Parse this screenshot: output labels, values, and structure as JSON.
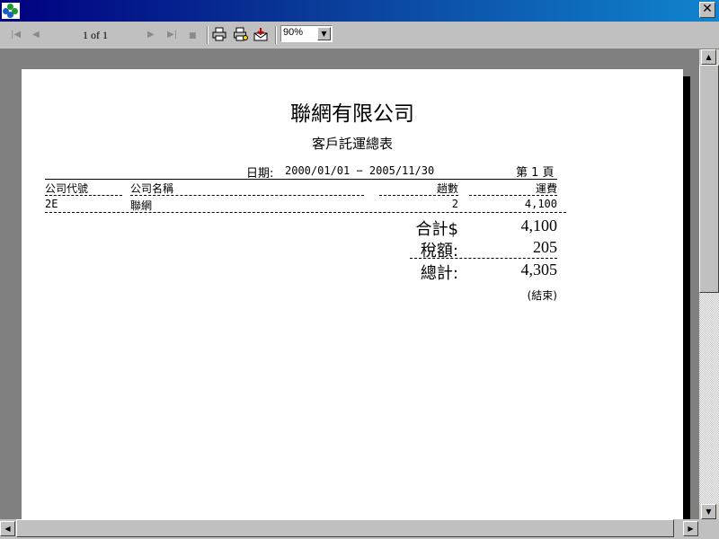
{
  "toolbar": {
    "page_indicator": "1 of 1",
    "zoom": "90%"
  },
  "report": {
    "company": "聯網有限公司",
    "title": "客戶託運總表",
    "date_label": "日期:",
    "date_range": "2000/01/01 − 2005/11/30",
    "page_label": "第 1 頁",
    "columns": {
      "code": "公司代號",
      "name": "公司名稱",
      "trips": "趟數",
      "fee": "運費"
    },
    "rows": [
      {
        "code": "2E",
        "name": "聯網",
        "trips": "2",
        "fee": "4,100"
      }
    ],
    "totals": {
      "subtotal_label": "合計$",
      "subtotal": "4,100",
      "tax_label": "稅額:",
      "tax": "205",
      "grand_label": "總計:",
      "grand": "4,305"
    },
    "end_mark": "(結束)"
  },
  "colors": {
    "titlebar_start": "#000080",
    "titlebar_end": "#1084d0",
    "chrome": "#c0c0c0",
    "viewport": "#808080"
  }
}
